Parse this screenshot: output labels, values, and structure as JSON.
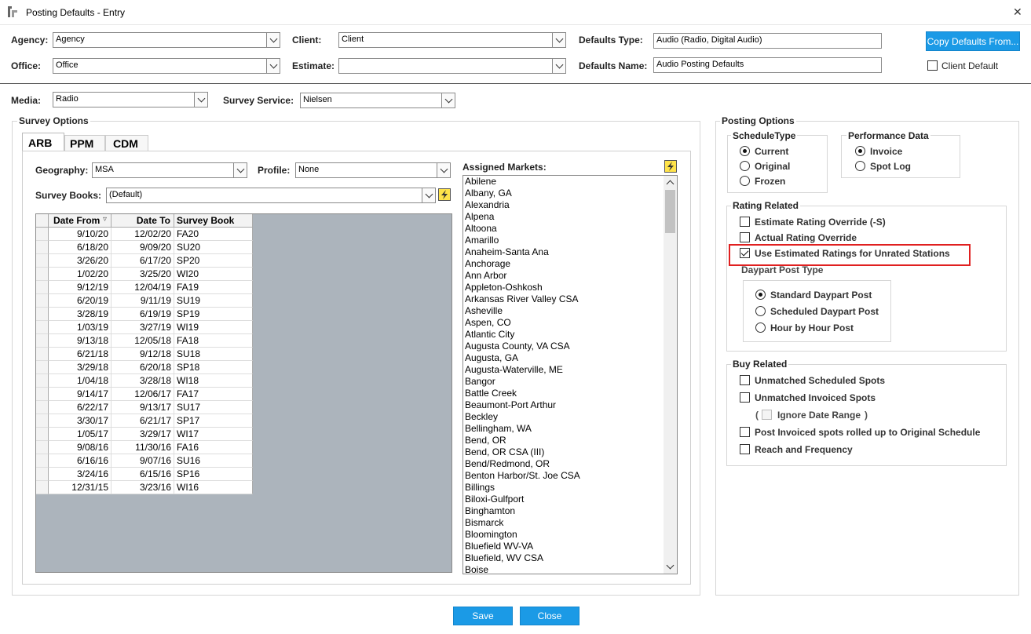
{
  "window": {
    "title": "Posting Defaults - Entry",
    "close_glyph": "✕"
  },
  "top": {
    "agency_label": "Agency:",
    "agency_value": "Agency",
    "client_label": "Client:",
    "client_value": "Client",
    "defaults_type_label": "Defaults Type:",
    "defaults_type_value": "Audio (Radio, Digital Audio)",
    "copy_defaults_label": "Copy Defaults From...",
    "office_label": "Office:",
    "office_value": "Office",
    "estimate_label": "Estimate:",
    "estimate_value": "",
    "defaults_name_label": "Defaults Name:",
    "defaults_name_value": "Audio Posting Defaults",
    "client_default_label": "Client Default"
  },
  "media": {
    "label": "Media:",
    "value": "Radio",
    "survey_service_label": "Survey Service:",
    "survey_service_value": "Nielsen"
  },
  "survey_options": {
    "title": "Survey Options",
    "tabs": [
      "ARB",
      "PPM",
      "CDM"
    ],
    "active_tab": "ARB",
    "geography_label": "Geography:",
    "geography_value": "MSA",
    "profile_label": "Profile:",
    "profile_value": "None",
    "survey_books_label": "Survey Books:",
    "survey_books_value": "(Default)",
    "grid_headers": {
      "date_from": "Date From",
      "date_to": "Date To",
      "survey_book": "Survey Book",
      "sort_glyph": "▿"
    },
    "books": [
      {
        "from": "9/10/20",
        "to": "12/02/20",
        "book": "FA20"
      },
      {
        "from": "6/18/20",
        "to": "9/09/20",
        "book": "SU20"
      },
      {
        "from": "3/26/20",
        "to": "6/17/20",
        "book": "SP20"
      },
      {
        "from": "1/02/20",
        "to": "3/25/20",
        "book": "WI20"
      },
      {
        "from": "9/12/19",
        "to": "12/04/19",
        "book": "FA19"
      },
      {
        "from": "6/20/19",
        "to": "9/11/19",
        "book": "SU19"
      },
      {
        "from": "3/28/19",
        "to": "6/19/19",
        "book": "SP19"
      },
      {
        "from": "1/03/19",
        "to": "3/27/19",
        "book": "WI19"
      },
      {
        "from": "9/13/18",
        "to": "12/05/18",
        "book": "FA18"
      },
      {
        "from": "6/21/18",
        "to": "9/12/18",
        "book": "SU18"
      },
      {
        "from": "3/29/18",
        "to": "6/20/18",
        "book": "SP18"
      },
      {
        "from": "1/04/18",
        "to": "3/28/18",
        "book": "WI18"
      },
      {
        "from": "9/14/17",
        "to": "12/06/17",
        "book": "FA17"
      },
      {
        "from": "6/22/17",
        "to": "9/13/17",
        "book": "SU17"
      },
      {
        "from": "3/30/17",
        "to": "6/21/17",
        "book": "SP17"
      },
      {
        "from": "1/05/17",
        "to": "3/29/17",
        "book": "WI17"
      },
      {
        "from": "9/08/16",
        "to": "11/30/16",
        "book": "FA16"
      },
      {
        "from": "6/16/16",
        "to": "9/07/16",
        "book": "SU16"
      },
      {
        "from": "3/24/16",
        "to": "6/15/16",
        "book": "SP16"
      },
      {
        "from": "12/31/15",
        "to": "3/23/16",
        "book": "WI16"
      }
    ],
    "assigned_markets_label": "Assigned Markets:",
    "markets": [
      "Abilene",
      "Albany, GA",
      "Alexandria",
      "Alpena",
      "Altoona",
      "Amarillo",
      "Anaheim-Santa Ana",
      "Anchorage",
      "Ann Arbor",
      "Appleton-Oshkosh",
      "Arkansas River Valley CSA",
      "Asheville",
      "Aspen, CO",
      "Atlantic City",
      "Augusta County, VA CSA",
      "Augusta, GA",
      "Augusta-Waterville, ME",
      "Bangor",
      "Battle Creek",
      "Beaumont-Port Arthur",
      "Beckley",
      "Bellingham, WA",
      "Bend, OR",
      "Bend, OR CSA (III)",
      "Bend/Redmond, OR",
      "Benton Harbor/St. Joe CSA",
      "Billings",
      "Biloxi-Gulfport",
      "Binghamton",
      "Bismarck",
      "Bloomington",
      "Bluefield WV-VA",
      "Bluefield, WV CSA",
      "Boise"
    ]
  },
  "posting_options": {
    "title": "Posting Options",
    "schedule_type": {
      "title": "ScheduleType",
      "options": [
        "Current",
        "Original",
        "Frozen"
      ],
      "selected": 0
    },
    "performance_data": {
      "title": "Performance Data",
      "options": [
        "Invoice",
        "Spot Log"
      ],
      "selected": 0
    },
    "rating_related": {
      "title": "Rating Related",
      "items": [
        {
          "label": "Estimate Rating Override (-S)",
          "checked": false
        },
        {
          "label": "Actual Rating Override",
          "checked": false
        },
        {
          "label": "Use Estimated Ratings for Unrated Stations",
          "checked": true
        }
      ],
      "daypart_title": "Daypart Post Type",
      "daypart_options": [
        "Standard Daypart Post",
        "Scheduled Daypart Post",
        "Hour by Hour Post"
      ],
      "daypart_selected": 0
    },
    "buy_related": {
      "title": "Buy Related",
      "items": [
        {
          "label": "Unmatched Scheduled Spots",
          "checked": false
        },
        {
          "label": "Unmatched Invoiced Spots",
          "checked": false
        },
        {
          "label": "Post Invoiced spots rolled up to Original Schedule",
          "checked": false
        },
        {
          "label": "Reach and Frequency",
          "checked": false
        }
      ],
      "ignore_open": "(",
      "ignore_label": "Ignore Date Range",
      "ignore_close": ")"
    }
  },
  "footer": {
    "save_label": "Save",
    "close_label": "Close"
  },
  "colors": {
    "accent": "#1b9ae6",
    "highlight": "#e02020",
    "grid_bg": "#acb4bc"
  }
}
